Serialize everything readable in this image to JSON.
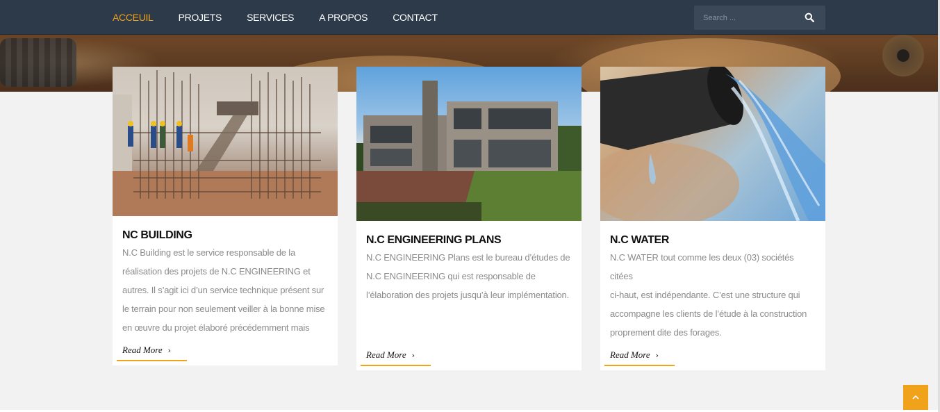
{
  "nav": {
    "items": [
      {
        "label": "ACCEUIL",
        "active": true
      },
      {
        "label": "PROJETS",
        "active": false
      },
      {
        "label": "SERVICES",
        "active": false
      },
      {
        "label": "A PROPOS",
        "active": false
      },
      {
        "label": "CONTACT",
        "active": false
      }
    ],
    "search_placeholder": "Search ...",
    "search_icon": "search-icon"
  },
  "colors": {
    "accent": "#f0a21b",
    "navbar": "#2c3a4a",
    "page_bg": "#f2f2f2"
  },
  "cards": [
    {
      "title": "NC BUILDING",
      "lines": [
        "N.C Building est le service responsable de la",
        "réalisation des projets de N.C ENGINEERING et",
        "autres. Il s’agit ici d’un service technique présent sur",
        "le terrain pour non seulement veiller à la bonne mise",
        "en œuvre du projet élaboré précédemment mais"
      ],
      "read_more": "Read More",
      "image": "construction-site-photo"
    },
    {
      "title": "N.C ENGINEERING PLANS",
      "lines": [
        "N.C ENGINEERING  Plans est le bureau d’études de",
        "N.C ENGINEERING qui est responsable de",
        "l’élaboration des projets jusqu’à leur implémentation."
      ],
      "read_more": "Read More",
      "image": "modern-house-photo"
    },
    {
      "title": "N.C WATER",
      "lines": [
        "N.C WATER tout comme les deux (03) sociétés citées",
        "ci-haut, est indépendante. C’est une structure qui",
        "accompagne les clients de l’étude à la construction",
        "proprement dite des forages."
      ],
      "read_more": "Read More",
      "image": "water-pipe-photo"
    }
  ],
  "back_to_top_icon": "chevron-up-icon"
}
